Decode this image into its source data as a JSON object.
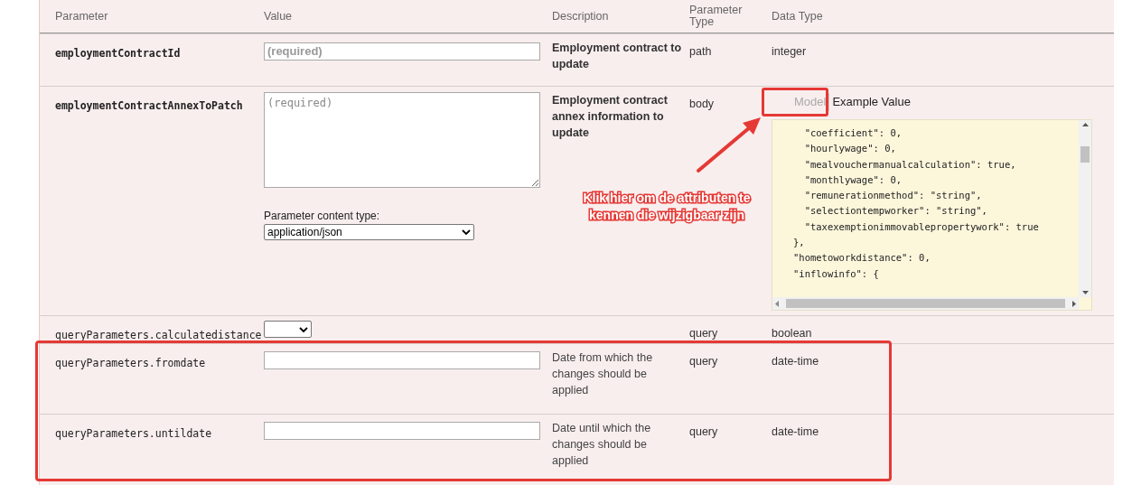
{
  "table": {
    "columns": [
      "Parameter",
      "Value",
      "Description",
      "Parameter\nType",
      "Data Type"
    ],
    "rows": [
      {
        "kind": "input",
        "name": "employmentContractId",
        "placeholder": "(required)",
        "description": "Employment contract to update",
        "param_type": "path",
        "data_type": "integer",
        "bold_description": true
      },
      {
        "kind": "body",
        "name": "employmentContractAnnexToPatch",
        "placeholder": "(required)",
        "description": "Employment contract annex information to update",
        "param_type": "body",
        "content_type_label": "Parameter content type:",
        "content_type": "application/json",
        "bold_description": true,
        "model_tabs": [
          {
            "label": "Model",
            "selected": false
          },
          {
            "label": "Example Value",
            "selected": true
          }
        ],
        "example_lines": [
          "  \"coefficient\": 0,",
          "  \"hourlywage\": 0,",
          "  \"mealvouchermanualcalculation\": true,",
          "  \"monthlywage\": 0,",
          "  \"remunerationmethod\": \"string\",",
          "  \"selectiontempworker\": \"string\",",
          "  \"taxexemptionimmovablepropertywork\": true",
          "},",
          "\"hometoworkdistance\": 0,",
          "\"inflowinfo\": {"
        ]
      },
      {
        "kind": "select",
        "name": "queryParameters.calculatedistance",
        "param_type": "query",
        "data_type": "boolean"
      },
      {
        "kind": "input",
        "name": "queryParameters.fromdate",
        "description": "Date from which the changes should be applied",
        "param_type": "query",
        "data_type": "date-time",
        "bold_description": false
      },
      {
        "kind": "input",
        "name": "queryParameters.untildate",
        "description": "Date until which the changes should be applied",
        "param_type": "query",
        "data_type": "date-time",
        "bold_description": false
      }
    ]
  },
  "annotation": {
    "callout": "Klik hier om de attributen te kennen die wijzigbaar zijn"
  }
}
